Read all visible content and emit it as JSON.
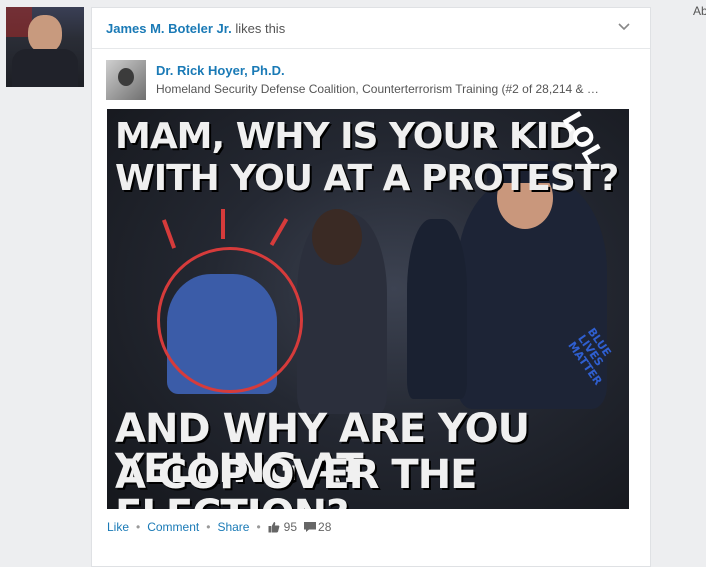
{
  "feed_item": {
    "actor_name": "James M. Boteler Jr.",
    "actor_action": " likes this",
    "author": {
      "name": "Dr. Rick Hoyer, Ph.D.",
      "headline": "Homeland Security Defense Coalition, Counterterrorism Training (#2 of 28,214 & …"
    },
    "image": {
      "caption_top_line1": "MAM, WHY IS YOUR KID",
      "caption_top_line2": "WITH YOU AT A PROTEST?",
      "caption_bottom_line1": "AND WHY ARE YOU YELLING AT",
      "caption_bottom_line2": "A COP OVER THE ELECTION?",
      "corner_text": "LOL",
      "watermark": "BLUE LIVES MATTER"
    },
    "actions": {
      "like": "Like",
      "comment": "Comment",
      "share": "Share",
      "likes_count": "95",
      "comments_count": "28"
    }
  },
  "right_rail": {
    "partial_text": "Ab"
  },
  "colors": {
    "link": "#1a7ab6",
    "background": "#edeef0",
    "annotation_red": "#d63b3b"
  },
  "icons": [
    "chevron-down-icon",
    "thumbs-up-icon",
    "comment-bubble-icon"
  ]
}
